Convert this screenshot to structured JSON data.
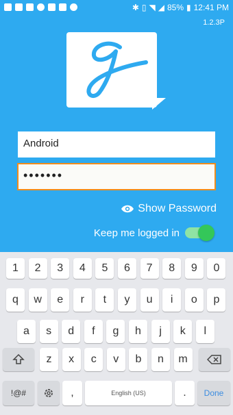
{
  "status_bar": {
    "left_icons": [
      "notification-icon",
      "linkedin-icon",
      "message-icon",
      "cloud-icon",
      "shield-icon",
      "gallery-icon",
      "badge-icon"
    ],
    "battery": "85%",
    "time": "12:41 PM"
  },
  "app": {
    "version": "1.2.3P",
    "logo_icon": "g-speech-bubble-logo",
    "username_value": "Android",
    "password_value": "•••••••",
    "show_password_label": "Show Password",
    "keep_logged_in_label": "Keep me logged in",
    "keep_logged_in_on": true
  },
  "keyboard": {
    "row1": [
      "1",
      "2",
      "3",
      "4",
      "5",
      "6",
      "7",
      "8",
      "9",
      "0"
    ],
    "row2": [
      "q",
      "w",
      "e",
      "r",
      "t",
      "y",
      "u",
      "i",
      "o",
      "p"
    ],
    "row3": [
      "a",
      "s",
      "d",
      "f",
      "g",
      "h",
      "j",
      "k",
      "l"
    ],
    "row4": [
      "z",
      "x",
      "c",
      "v",
      "b",
      "n",
      "m"
    ],
    "symbols_label": "!@#",
    "comma_label": ",",
    "space_label": "English (US)",
    "period_label": ".",
    "done_label": "Done"
  },
  "colors": {
    "app_bg": "#2eaaf0",
    "accent_orange": "#f28c1b",
    "toggle_green": "#34c759"
  }
}
